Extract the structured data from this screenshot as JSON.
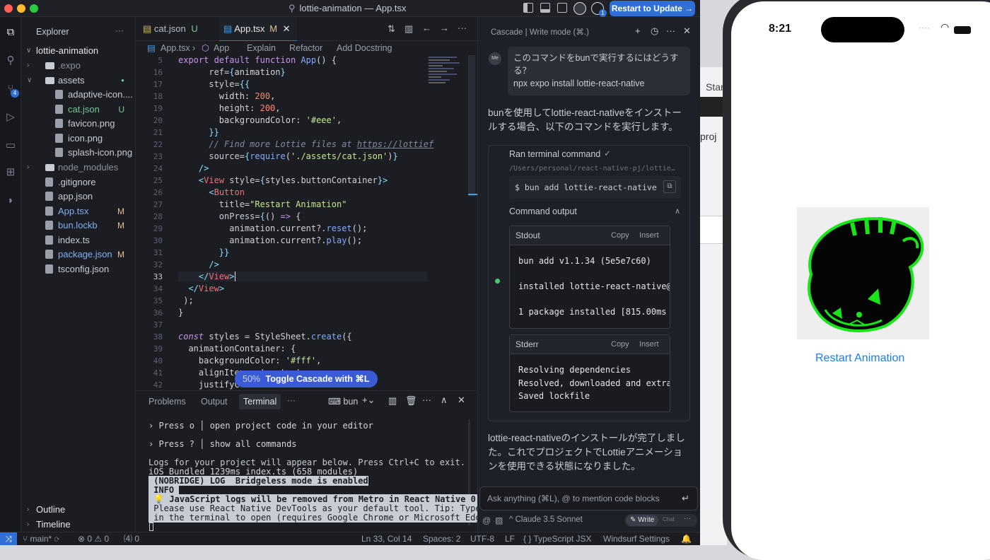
{
  "window": {
    "title": "lottie-animation — App.tsx",
    "update_button": "Restart to Update →"
  },
  "activity_bar": {
    "source_control_badge": "4"
  },
  "explorer": {
    "title": "Explorer",
    "more": "···",
    "root": "lottie-animation",
    "items": [
      {
        "label": ".expo",
        "status": ""
      },
      {
        "label": "assets",
        "status": "●"
      },
      {
        "label": "adaptive-icon....",
        "status": ""
      },
      {
        "label": "cat.json",
        "status": "U"
      },
      {
        "label": "favicon.png",
        "status": ""
      },
      {
        "label": "icon.png",
        "status": ""
      },
      {
        "label": "splash-icon.png",
        "status": ""
      },
      {
        "label": "node_modules",
        "status": ""
      },
      {
        "label": ".gitignore",
        "status": ""
      },
      {
        "label": "app.json",
        "status": ""
      },
      {
        "label": "App.tsx",
        "status": "M"
      },
      {
        "label": "bun.lockb",
        "status": "M"
      },
      {
        "label": "index.ts",
        "status": ""
      },
      {
        "label": "package.json",
        "status": "M"
      },
      {
        "label": "tsconfig.json",
        "status": ""
      }
    ],
    "outline": "Outline",
    "timeline": "Timeline"
  },
  "editor": {
    "tabs": [
      {
        "label": "cat.json",
        "status": "U"
      },
      {
        "label": "App.tsx",
        "status": "M",
        "close": "✕"
      }
    ],
    "breadcrumb": {
      "file": "App.tsx",
      "symbol": "App",
      "explain": "Explain",
      "refactor": "Refactor",
      "docstring": "Add Docstring"
    },
    "line_numbers": [
      "5",
      "16",
      "17",
      "18",
      "19",
      "20",
      "21",
      "22",
      "23",
      "24",
      "25",
      "26",
      "27",
      "28",
      "29",
      "30",
      "31",
      "32",
      "33",
      "34",
      "35",
      "36",
      "37",
      "38",
      "39",
      "40",
      "41",
      "42"
    ],
    "toast": {
      "percent": "50%",
      "label": "Toggle Cascade with ⌘L",
      "close": "×"
    }
  },
  "panel": {
    "tabs": {
      "problems": "Problems",
      "output": "Output",
      "terminal": "Terminal",
      "more": "···"
    },
    "shell": "bun",
    "lines": [
      "› Press o │ open project code in your editor",
      "› Press ? │ show all commands",
      "Logs for your project will appear below. Press Ctrl+C to exit.",
      "iOS Bundled 1239ms index.ts (658 modules)",
      " (NOBRIDGE) LOG  Bridgeless mode is enabled",
      " INFO ",
      " 💡 JavaScript logs will be removed from Metro in React Native 0.77!",
      " Please use React Native DevTools as your default tool. Tip: Type j",
      " in the terminal to open (requires Google Chrome or Microsoft Edge)."
    ]
  },
  "cascade": {
    "header": "Cascade | Write mode (⌘.)",
    "user_badge": "Me",
    "user_message": "このコマンドをbunで実行するにはどうする？\nnpx expo install lottie-react-native",
    "reply1": "bunを使用してlottie-react-nativeをインストールする場合、以下のコマンドを実行します。",
    "ran_label": "Ran terminal command",
    "path": "/Users/personal/react-native-pj/lottie…",
    "command": "$ bun add lottie-react-native",
    "output_label": "Command output",
    "stdout_label": "Stdout",
    "copy": "Copy",
    "insert": "Insert",
    "stdout_lines": [
      "bun add v1.1.34 (5e5e7c60)",
      "installed lottie-react-native@",
      "1 package installed [815.00ms"
    ],
    "stderr_label": "Stderr",
    "stderr_lines": [
      "Resolving dependencies",
      "Resolved, downloaded and extra",
      "Saved lockfile"
    ],
    "reply2": "lottie-react-nativeのインストールが完了しました。これでプロジェクトでLottieアニメーションを使用できる状態になりました。",
    "input_placeholder": "Ask anything (⌘L), @ to mention code blocks",
    "model": "Claude 3.5 Sonnet",
    "write": "Write",
    "chat": "Chat"
  },
  "statusbar": {
    "branch": "main*",
    "errors": "⊗ 0 ⚠ 0",
    "ports": "⑷ 0",
    "position": "Ln 33, Col 14",
    "spaces": "Spaces: 2",
    "encoding": "UTF-8",
    "eol": "LF",
    "language": "{ } TypeScript JSX",
    "settings": "Windsurf Settings"
  },
  "background_window": {
    "text1": "Star",
    "text2": "proj"
  },
  "phone": {
    "time": "8:21",
    "button": "Restart Animation"
  },
  "colors": {
    "accent": "#2f6fd6",
    "ios_link": "#1a7fe8",
    "cat_green": "#19e619"
  }
}
